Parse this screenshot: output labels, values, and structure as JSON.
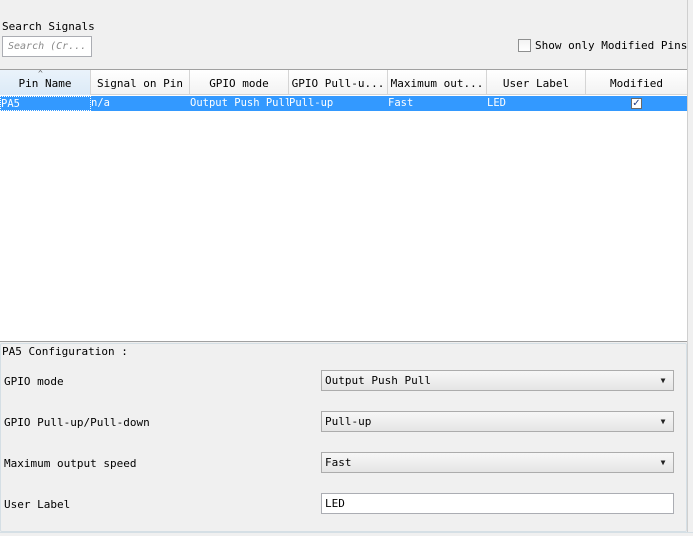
{
  "search": {
    "label": "Search Signals",
    "placeholder": "Search (Cr..."
  },
  "show_modified": {
    "label": "Show only Modified Pins",
    "checked": false
  },
  "table": {
    "columns": [
      "Pin Name",
      "Signal on Pin",
      "GPIO mode",
      "GPIO Pull-u...",
      "Maximum out...",
      "User Label",
      "Modified"
    ],
    "sorted_column": "Pin Name",
    "rows": [
      {
        "pin_name": "PA5",
        "signal": "n/a",
        "gpio_mode": "Output Push Pull",
        "pull": "Pull-up",
        "speed": "Fast",
        "user_label": "LED",
        "modified": true
      }
    ]
  },
  "config": {
    "title": "PA5 Configuration :",
    "gpio_mode_label": "GPIO mode",
    "gpio_mode_value": "Output Push Pull",
    "pull_label": "GPIO Pull-up/Pull-down",
    "pull_value": "Pull-up",
    "speed_label": "Maximum output speed",
    "speed_value": "Fast",
    "user_label_label": "User Label",
    "user_label_value": "LED"
  },
  "icons": {
    "combo_arrow": "chevron-down-icon",
    "sort": "sort-ascending-icon",
    "check": "checkmark-icon"
  }
}
